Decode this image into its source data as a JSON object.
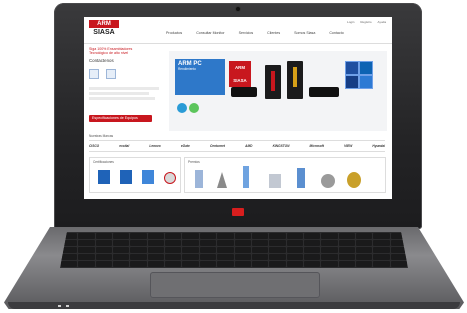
{
  "site": {
    "logo_top": "ARM",
    "logo_bottom": "SIASA",
    "nav": [
      "Productos",
      "Consultar Monitor",
      "Servicios",
      "Clientes",
      "Somos Siasa",
      "Contacto"
    ],
    "top_links": [
      "Login",
      "Registro",
      "Ayuda"
    ],
    "left_red_text": "Siga 100% Ensambladores",
    "left_red_text_2": "Tecnológico de alto nivel",
    "contact_title": "Contactenos",
    "spec_button": "Especificaciones de Equipos",
    "brands_label": "Nuestras Marcas",
    "brands": [
      "CISCO",
      "excital",
      "Lenovo",
      "eGate",
      "Centurnet",
      "AMD",
      "KINGSTON",
      "Microsoft",
      "VIEW",
      "Hyundai"
    ],
    "certifications_label": "Certificaciones",
    "awards_label": "Premios",
    "banner_title": "ARM PC",
    "banner_subtitle": "Rendimiento",
    "banner_logo": "ARM SIASA"
  },
  "colors": {
    "brand_red": "#c8171e",
    "brand_blue": "#2e78c9",
    "bezel": "#242426",
    "chassis": "#7a7a7d"
  },
  "icons": {
    "camera": "camera-icon",
    "lid_logo": "brand-logo-icon"
  }
}
